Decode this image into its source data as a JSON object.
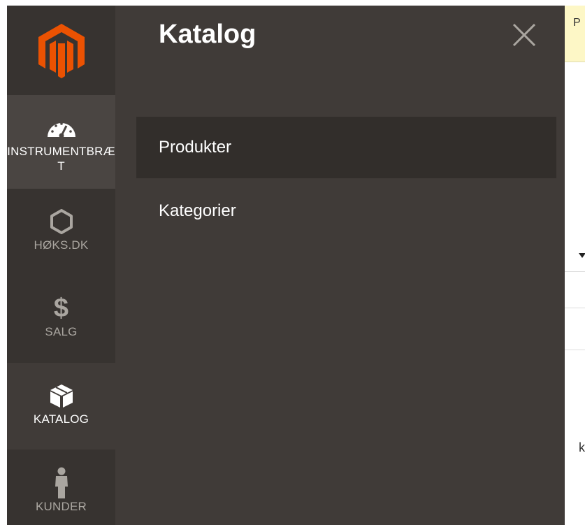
{
  "background": {
    "top_fragment": "P",
    "right_letter": "k"
  },
  "sidebar": {
    "logo_label": "magento-logo",
    "items": [
      {
        "label": "INSTRUMENTBRÆT",
        "icon": "dashboard-icon",
        "state": "hover"
      },
      {
        "label": "HØKS.DK",
        "icon": "hexagon-icon",
        "state": "normal"
      },
      {
        "label": "SALG",
        "icon": "dollar-icon",
        "state": "normal"
      },
      {
        "label": "KATALOG",
        "icon": "box-icon",
        "state": "active"
      },
      {
        "label": "KUNDER",
        "icon": "person-icon",
        "state": "normal"
      }
    ]
  },
  "panel": {
    "title": "Katalog",
    "close_icon": "close-icon",
    "items": [
      {
        "label": "Produkter",
        "selected": true
      },
      {
        "label": "Kategorier",
        "selected": false
      }
    ]
  },
  "colors": {
    "sidebar_bg": "#373330",
    "panel_bg": "#403b38",
    "logo_orange": "#eb5202",
    "text_white": "#ffffff",
    "text_muted": "#aaa6a0"
  }
}
